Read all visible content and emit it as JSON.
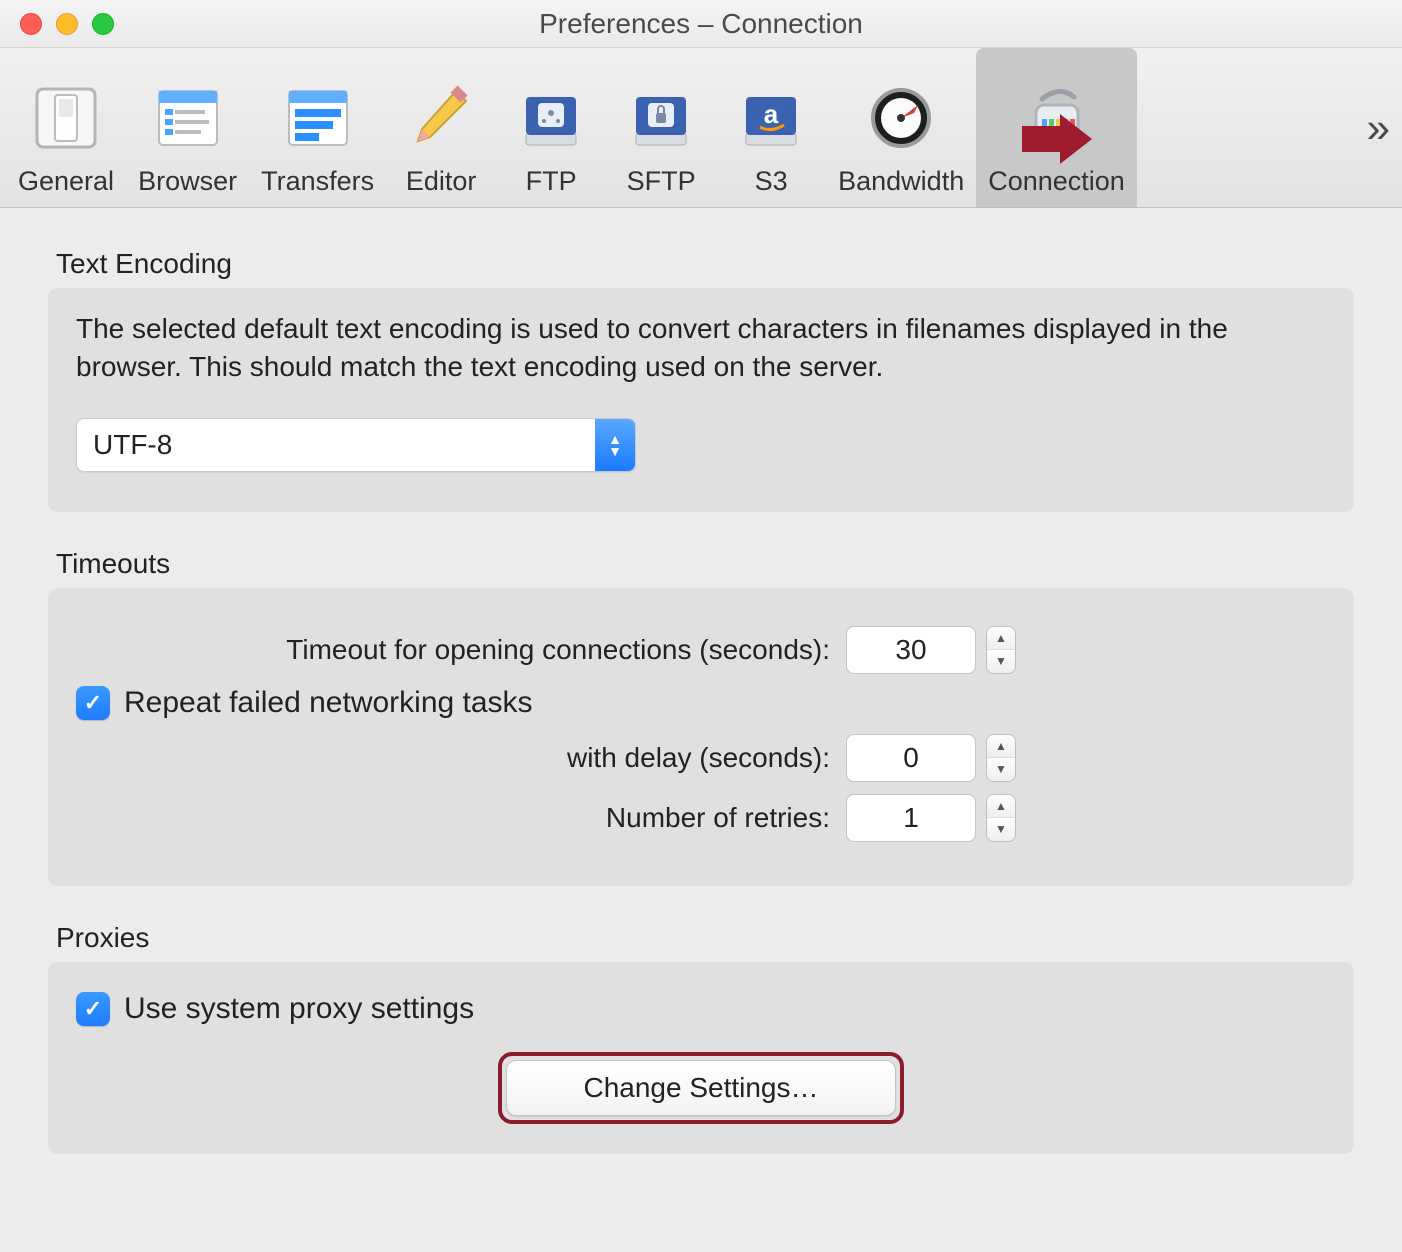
{
  "window": {
    "title": "Preferences – Connection"
  },
  "toolbar": {
    "items": [
      {
        "label": "General"
      },
      {
        "label": "Browser"
      },
      {
        "label": "Transfers"
      },
      {
        "label": "Editor"
      },
      {
        "label": "FTP"
      },
      {
        "label": "SFTP"
      },
      {
        "label": "S3"
      },
      {
        "label": "Bandwidth"
      },
      {
        "label": "Connection"
      }
    ],
    "overflow": "»"
  },
  "sections": {
    "encoding": {
      "title": "Text Encoding",
      "description": "The selected default text encoding is used to convert characters in filenames displayed in the browser. This should match the text encoding used on the server.",
      "selected": "UTF-8"
    },
    "timeouts": {
      "title": "Timeouts",
      "timeout_label": "Timeout for opening connections (seconds):",
      "timeout_value": "30",
      "repeat_label": "Repeat failed networking tasks",
      "repeat_checked": true,
      "delay_label": "with delay (seconds):",
      "delay_value": "0",
      "retries_label": "Number of retries:",
      "retries_value": "1"
    },
    "proxies": {
      "title": "Proxies",
      "use_system_label": "Use system proxy settings",
      "use_system_checked": true,
      "change_button": "Change Settings…"
    }
  }
}
